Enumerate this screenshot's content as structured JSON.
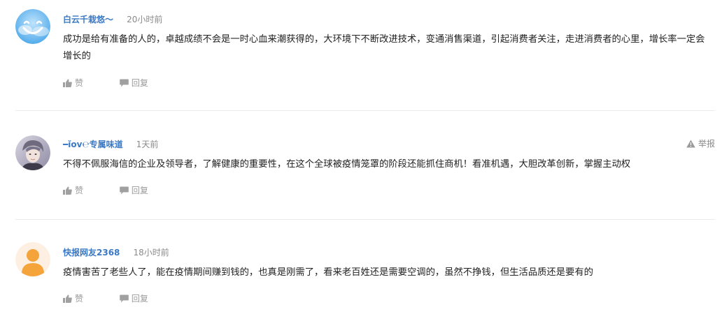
{
  "comments": [
    {
      "username": "白云千栽悠～",
      "time": "20小时前",
      "text": "成功是给有准备的人的，卓越成绩不会是一时心血来潮获得的，大环境下不断改进技术，变通消售渠道，引起消费者关注，走进消费者的心里，增长率一定会增长的",
      "like_label": "赞",
      "reply_label": "回复",
      "avatar": "cloud-smile-avatar"
    },
    {
      "username": "━ǐov℮专属味道",
      "time": "1天前",
      "text": "不得不佩服海信的企业及领导者，了解健康的重要性，在这个全球被疫情笼罩的阶段还能抓住商机！看准机遇，大胆改革创新，掌握主动权",
      "like_label": "赞",
      "reply_label": "回复",
      "report_label": "举报",
      "avatar": "photo-avatar"
    },
    {
      "username": "快报网友2368",
      "time": "18小时前",
      "text": "疫情害苦了老些人了，能在疫情期间赚到钱的，也真是刚需了，看来老百姓还是需要空调的，虽然不挣钱，但生活品质还是要有的",
      "like_label": "赞",
      "reply_label": "回复",
      "avatar": "default-user-avatar"
    }
  ],
  "colors": {
    "username": "#3b79c4",
    "meta": "#8a8a8a",
    "body": "#222222",
    "action": "#9a9a9a",
    "divider": "#ececec",
    "default_avatar": "#f5a33b"
  }
}
